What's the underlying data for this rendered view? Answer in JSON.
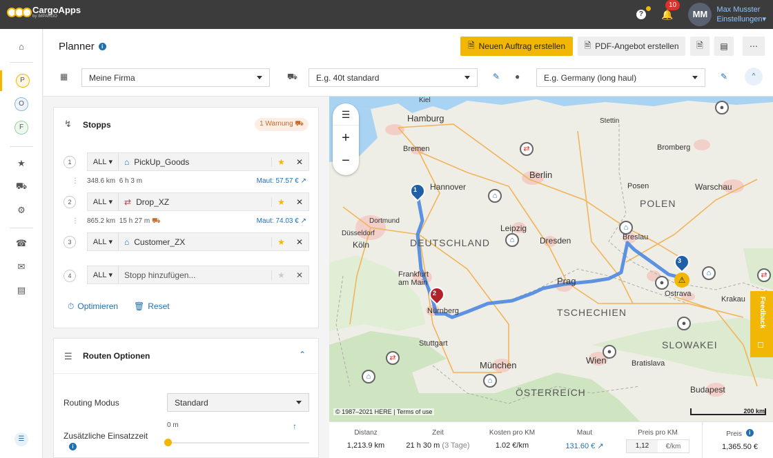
{
  "app": {
    "name": "CargoApps",
    "subname": "by IMPARGO"
  },
  "top": {
    "notifications": "10",
    "avatar": "MM",
    "user_name": "Max Musster",
    "settings": "Einstellungen"
  },
  "sidebar": {
    "letters": [
      "P",
      "O",
      "F"
    ]
  },
  "header": {
    "title": "Planner",
    "new_order": "Neuen Auftrag erstellen",
    "pdf_offer": "PDF-Angebot erstellen",
    "company": "Meine Firma",
    "vehicle": "E.g. 40t standard",
    "profile": "E.g. Germany (long haul)"
  },
  "stops": {
    "title": "Stopps",
    "warning": "1 Warnung",
    "items": [
      {
        "num": "1",
        "filter": "ALL",
        "name": "PickUp_Goods",
        "icon": "house-icon"
      },
      {
        "num": "2",
        "filter": "ALL",
        "name": "Drop_XZ",
        "icon": "exchange-icon"
      },
      {
        "num": "3",
        "filter": "ALL",
        "name": "Customer_ZX",
        "icon": "house-icon"
      },
      {
        "num": "4",
        "filter": "ALL",
        "placeholder": "Stopp hinzufügen..."
      }
    ],
    "legs": [
      {
        "dist": "348.6 km",
        "time": "6 h 3 m",
        "maut": "Maut: 57.57 €"
      },
      {
        "dist": "865.2 km",
        "time": "15 h 27 m",
        "maut": "Maut: 74.03 €"
      }
    ],
    "optimize": "Optimieren",
    "reset": "Reset"
  },
  "route_options": {
    "title": "Routen Optionen",
    "routing_label": "Routing Modus",
    "routing_value": "Standard",
    "extra_time_label": "Zusätzliche Einsatzzeit",
    "extra_time_value": "0 m"
  },
  "map": {
    "copyright": "© 1987–2021 HERE | Terms of use",
    "scale": "200 km",
    "feedback": "Feedback",
    "labels": [
      {
        "text": "Hamburg"
      },
      {
        "text": "Bremen"
      },
      {
        "text": "Hannover"
      },
      {
        "text": "Berlin"
      },
      {
        "text": "DEUTSCHLAND"
      },
      {
        "text": "POLEN"
      },
      {
        "text": "TSCHECHIEN"
      },
      {
        "text": "ÖSTERREICH"
      },
      {
        "text": "SLOWAKEI"
      },
      {
        "text": "Warschau"
      },
      {
        "text": "Prag"
      },
      {
        "text": "Wien"
      },
      {
        "text": "München"
      },
      {
        "text": "Nürnberg"
      },
      {
        "text": "Frankfurt am Main"
      },
      {
        "text": "Köln"
      },
      {
        "text": "Leipzig"
      },
      {
        "text": "Dresden"
      },
      {
        "text": "Breslau"
      },
      {
        "text": "Ostrava"
      },
      {
        "text": "Budapest"
      },
      {
        "text": "Stuttgart"
      },
      {
        "text": "Posen"
      },
      {
        "text": "Bromberg"
      },
      {
        "text": "Krakau"
      },
      {
        "text": "Bratislava"
      },
      {
        "text": "Düsseldorf"
      },
      {
        "text": "Dortmund"
      },
      {
        "text": "Stettin"
      },
      {
        "text": "Kiel"
      }
    ]
  },
  "stats": {
    "distance_label": "Distanz",
    "distance": "1,213.9 km",
    "time_label": "Zeit",
    "time": "21 h 30 m",
    "time_days": "(3 Tage)",
    "cost_km_label": "Kosten pro KM",
    "cost_km": "1.02 €/km",
    "maut_label": "Maut",
    "maut": "131.60 €",
    "price_km_label": "Preis pro KM",
    "price_km": "1,12",
    "price_km_unit": "€/km",
    "price_label": "Preis",
    "price": "1,365.50 €"
  }
}
